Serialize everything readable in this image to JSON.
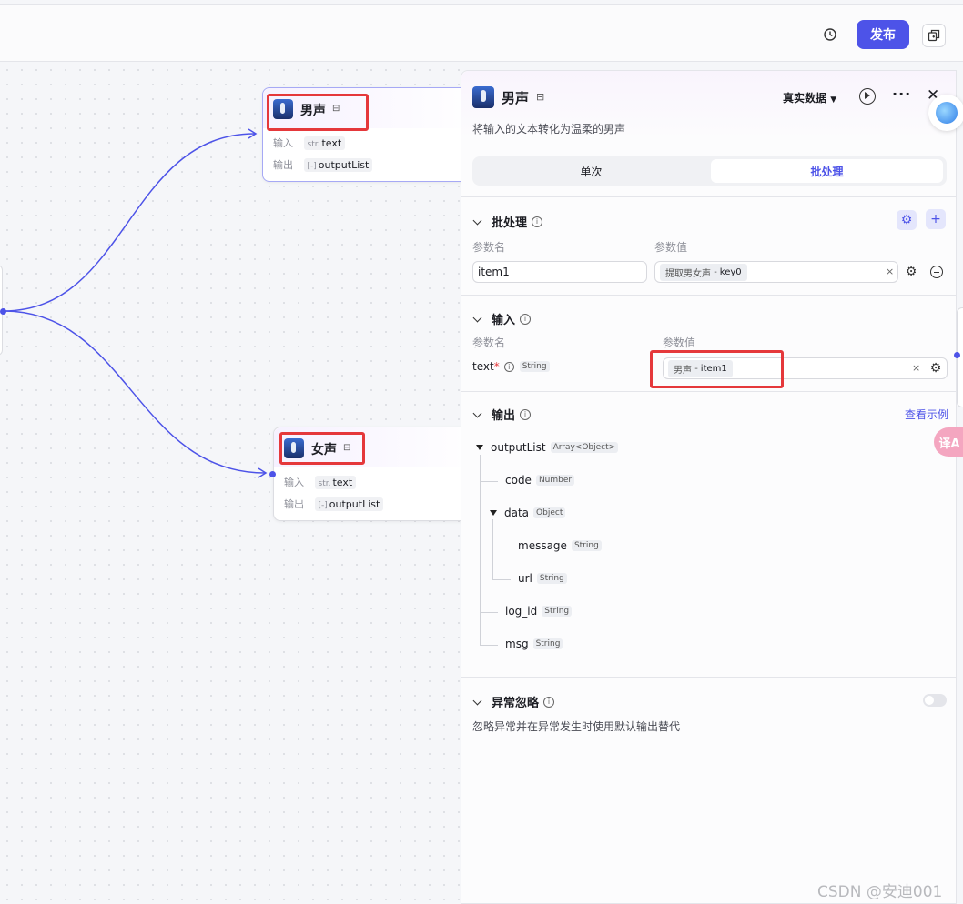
{
  "toolbar": {
    "history_icon": "history-icon",
    "publish_label": "发布",
    "copy_icon": "copy-icon"
  },
  "canvas": {
    "nodes": [
      {
        "title": "男声",
        "badge_icon": "plugin-icon",
        "input_label": "输入",
        "input_prefix": "str.",
        "input_value": "text",
        "output_label": "输出",
        "output_prefix": "[-]",
        "output_value": "outputList"
      },
      {
        "title": "女声",
        "badge_icon": "plugin-icon",
        "input_label": "输入",
        "input_prefix": "str.",
        "input_value": "text",
        "output_label": "输出",
        "output_prefix": "[-]",
        "output_value": "outputList"
      }
    ],
    "edge_color": "#4d53e8"
  },
  "panel": {
    "title": "男声",
    "description": "将输入的文本转化为温柔的男声",
    "data_mode_label": "真实数据",
    "tabs": [
      "单次",
      "批处理"
    ],
    "active_tab": "批处理",
    "batch": {
      "title": "批处理",
      "col_name": "参数名",
      "col_value": "参数值",
      "param_name": "item1",
      "param_ref_source": "提取男女声",
      "param_ref_sep": "-",
      "param_ref_var": "key0"
    },
    "input": {
      "title": "输入",
      "col_name": "参数名",
      "col_value": "参数值",
      "param_name": "text",
      "required_mark": "*",
      "param_type": "String",
      "ref_source": "男声",
      "ref_sep": "-",
      "ref_var": "item1"
    },
    "output": {
      "title": "输出",
      "example_link": "查看示例",
      "tree": [
        {
          "name": "outputList",
          "type": "Array<Object>"
        },
        {
          "name": "code",
          "type": "Number"
        },
        {
          "name": "data",
          "type": "Object"
        },
        {
          "name": "message",
          "type": "String"
        },
        {
          "name": "url",
          "type": "String"
        },
        {
          "name": "log_id",
          "type": "String"
        },
        {
          "name": "msg",
          "type": "String"
        }
      ]
    },
    "exception": {
      "title": "异常忽略",
      "description": "忽略异常并在异常发生时使用默认输出替代",
      "enabled": false
    }
  },
  "floating": {
    "translate_label": "译A"
  },
  "watermark": "CSDN @安迪001",
  "colors": {
    "accent": "#4d53e8",
    "highlight": "#e5383b"
  }
}
